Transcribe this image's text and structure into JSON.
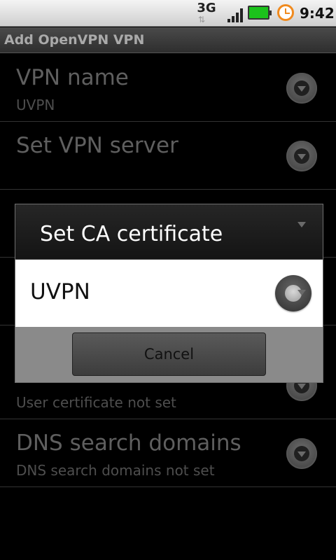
{
  "status_bar": {
    "network": "3G",
    "time": "9:42"
  },
  "title_bar": {
    "title": "Add OpenVPN VPN"
  },
  "rows": [
    {
      "label": "VPN name",
      "sub": "UVPN"
    },
    {
      "label": "Set VPN server",
      "sub": ""
    },
    {
      "label": "",
      "sub": ""
    },
    {
      "label": "",
      "sub": ""
    },
    {
      "label": "",
      "sub": "User certificate not set"
    },
    {
      "label": "DNS search domains",
      "sub": "DNS search domains not set"
    }
  ],
  "dialog": {
    "title": "Set CA certificate",
    "options": [
      {
        "label": "UVPN"
      }
    ],
    "cancel_label": "Cancel"
  }
}
